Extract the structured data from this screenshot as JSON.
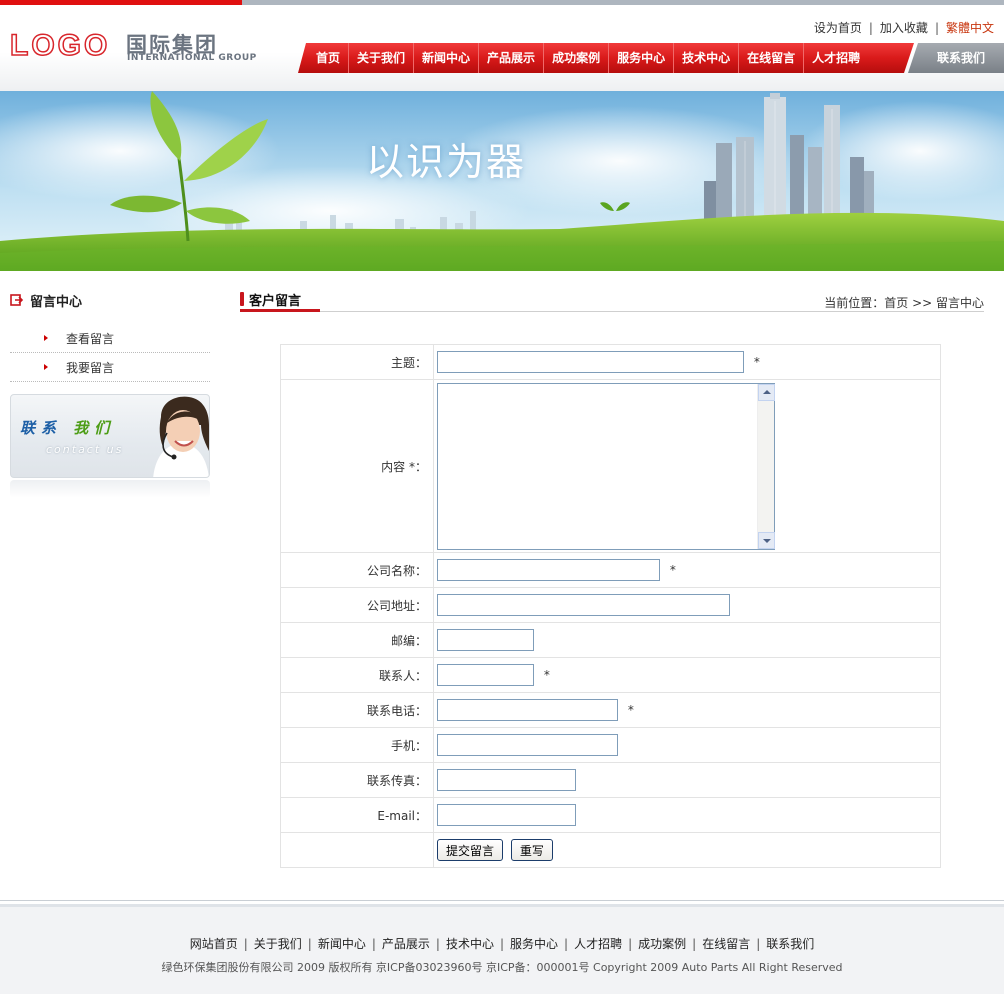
{
  "header": {
    "logo_mark": "LOGO",
    "logo_cn": "国际集团",
    "logo_en": "INTERNATIONAL GROUP",
    "quicklinks": [
      "设为首页",
      "加入收藏",
      "繁體中文"
    ]
  },
  "nav": {
    "items": [
      "首页",
      "关于我们",
      "新闻中心",
      "产品展示",
      "成功案例",
      "服务中心",
      "技术中心",
      "在线留言",
      "人才招聘"
    ],
    "contact": "联系我们"
  },
  "banner": {
    "title": "以识为器"
  },
  "sidebar": {
    "title": "留言中心",
    "items": [
      "查看留言",
      "我要留言"
    ],
    "contact_card": {
      "cn_blue": "联系",
      "cn_green": "我们",
      "en": "contact us"
    }
  },
  "main": {
    "title": "客户留言",
    "breadcrumb": "当前位置：首页 >> 留言中心"
  },
  "form": {
    "subject_label": "主题：",
    "content_label": "内容 *：",
    "company_label": "公司名称：",
    "address_label": "公司地址：",
    "postcode_label": "邮编：",
    "contact_label": "联系人：",
    "phone_label": "联系电话：",
    "mobile_label": "手机：",
    "fax_label": "联系传真：",
    "email_label": "E-mail：",
    "required_mark": "*",
    "submit_label": "提交留言",
    "reset_label": "重写"
  },
  "footer": {
    "links": [
      "网站首页",
      "关于我们",
      "新闻中心",
      "产品展示",
      "技术中心",
      "服务中心",
      "人才招聘",
      "成功案例",
      "在线留言",
      "联系我们"
    ],
    "copyright": "绿色环保集团股份有限公司 2009 版权所有 京ICP备03023960号 京ICP备：000001号 Copyright 2009 Auto Parts All Right Reserved"
  },
  "colors": {
    "brand_red": "#c8161d",
    "nav_gray": "#8a8f95",
    "link_highlight": "#c8360f"
  }
}
